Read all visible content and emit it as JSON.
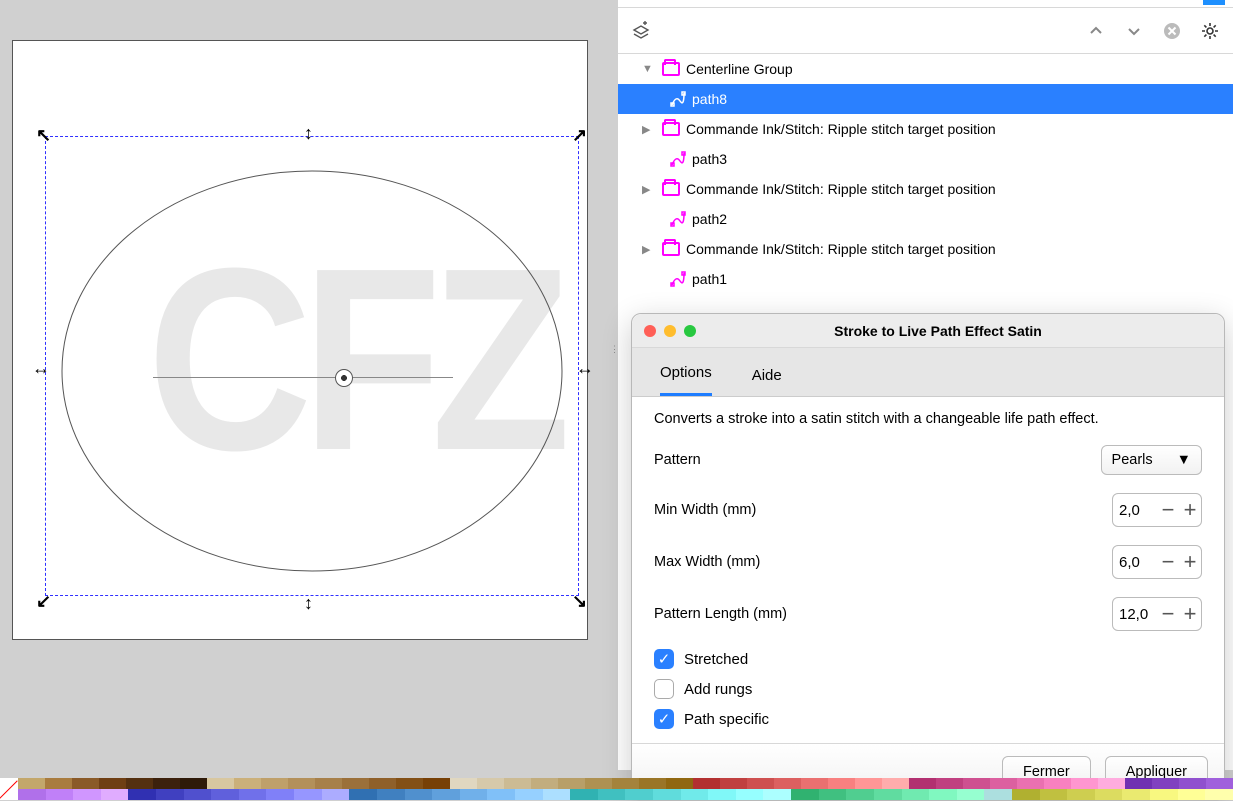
{
  "layer_tree": {
    "items": [
      {
        "label": "Centerline Group",
        "type": "folder"
      },
      {
        "label": "path8",
        "type": "path",
        "selected": true
      },
      {
        "label": "Commande Ink/Stitch: Ripple stitch target position",
        "type": "folder"
      },
      {
        "label": "path3",
        "type": "path"
      },
      {
        "label": "Commande Ink/Stitch: Ripple stitch target position",
        "type": "folder"
      },
      {
        "label": "path2",
        "type": "path"
      },
      {
        "label": "Commande Ink/Stitch: Ripple stitch target position",
        "type": "folder"
      },
      {
        "label": "path1",
        "type": "path"
      }
    ]
  },
  "dialog": {
    "title": "Stroke to Live Path Effect Satin",
    "tabs": {
      "options": "Options",
      "help": "Aide"
    },
    "description": "Converts a stroke into a satin stitch with a changeable life path effect.",
    "pattern_label": "Pattern",
    "pattern_value": "Pearls",
    "min_width_label": "Min Width (mm)",
    "min_width_value": "2,0",
    "max_width_label": "Max Width (mm)",
    "max_width_value": "6,0",
    "pattern_length_label": "Pattern Length (mm)",
    "pattern_length_value": "12,0",
    "stretched_label": "Stretched",
    "add_rungs_label": "Add rungs",
    "path_specific_label": "Path specific",
    "close_label": "Fermer",
    "apply_label": "Appliquer"
  },
  "canvas": {
    "monogram_text": "CFZ"
  },
  "palette_colors": [
    "#c3a76b",
    "#a97c3f",
    "#8a5a28",
    "#6f3f14",
    "#543010",
    "#3c210c",
    "#2e1a09",
    "#d8c7a0",
    "#cbb07a",
    "#bfa06a",
    "#b3905a",
    "#a7804a",
    "#9b703a",
    "#8f602a",
    "#835016",
    "#774006",
    "#e0d7c0",
    "#d6c9aa",
    "#ccbb94",
    "#c2ad7e",
    "#b89f68",
    "#ae9152",
    "#a4833c",
    "#9a7526",
    "#906710",
    "#b23030",
    "#c04040",
    "#ce5050",
    "#dc6060",
    "#ea7070",
    "#f88080",
    "#ff9696",
    "#ffacac",
    "#b23070",
    "#c04080",
    "#ce5090",
    "#dc60a0",
    "#ea70b0",
    "#f880c0",
    "#ff96d0",
    "#ffacdf",
    "#7030b2",
    "#8040c0",
    "#9050ce",
    "#a060dc",
    "#b070ea",
    "#c080f8",
    "#d096ff",
    "#e0acff",
    "#3030b2",
    "#4040c0",
    "#5050ce",
    "#6060dc",
    "#7070ea",
    "#8080f8",
    "#9696ff",
    "#acacff",
    "#3070b2",
    "#4080c0",
    "#5090ce",
    "#60a0dc",
    "#70b0ea",
    "#80c0f8",
    "#96d0ff",
    "#acdfff",
    "#30b2b2",
    "#40c0c0",
    "#50cece",
    "#60dcdc",
    "#70eaea",
    "#80f8f8",
    "#96ffff",
    "#acffff",
    "#30b270",
    "#40c080",
    "#50ce90",
    "#60dca0",
    "#70eab0",
    "#80f8c0",
    "#96ffd0",
    "#acdfdf",
    "#b0b030",
    "#c0c040",
    "#cece50",
    "#dcdc60",
    "#eaea70",
    "#f8f880",
    "#ffff96",
    "#ffffac"
  ]
}
